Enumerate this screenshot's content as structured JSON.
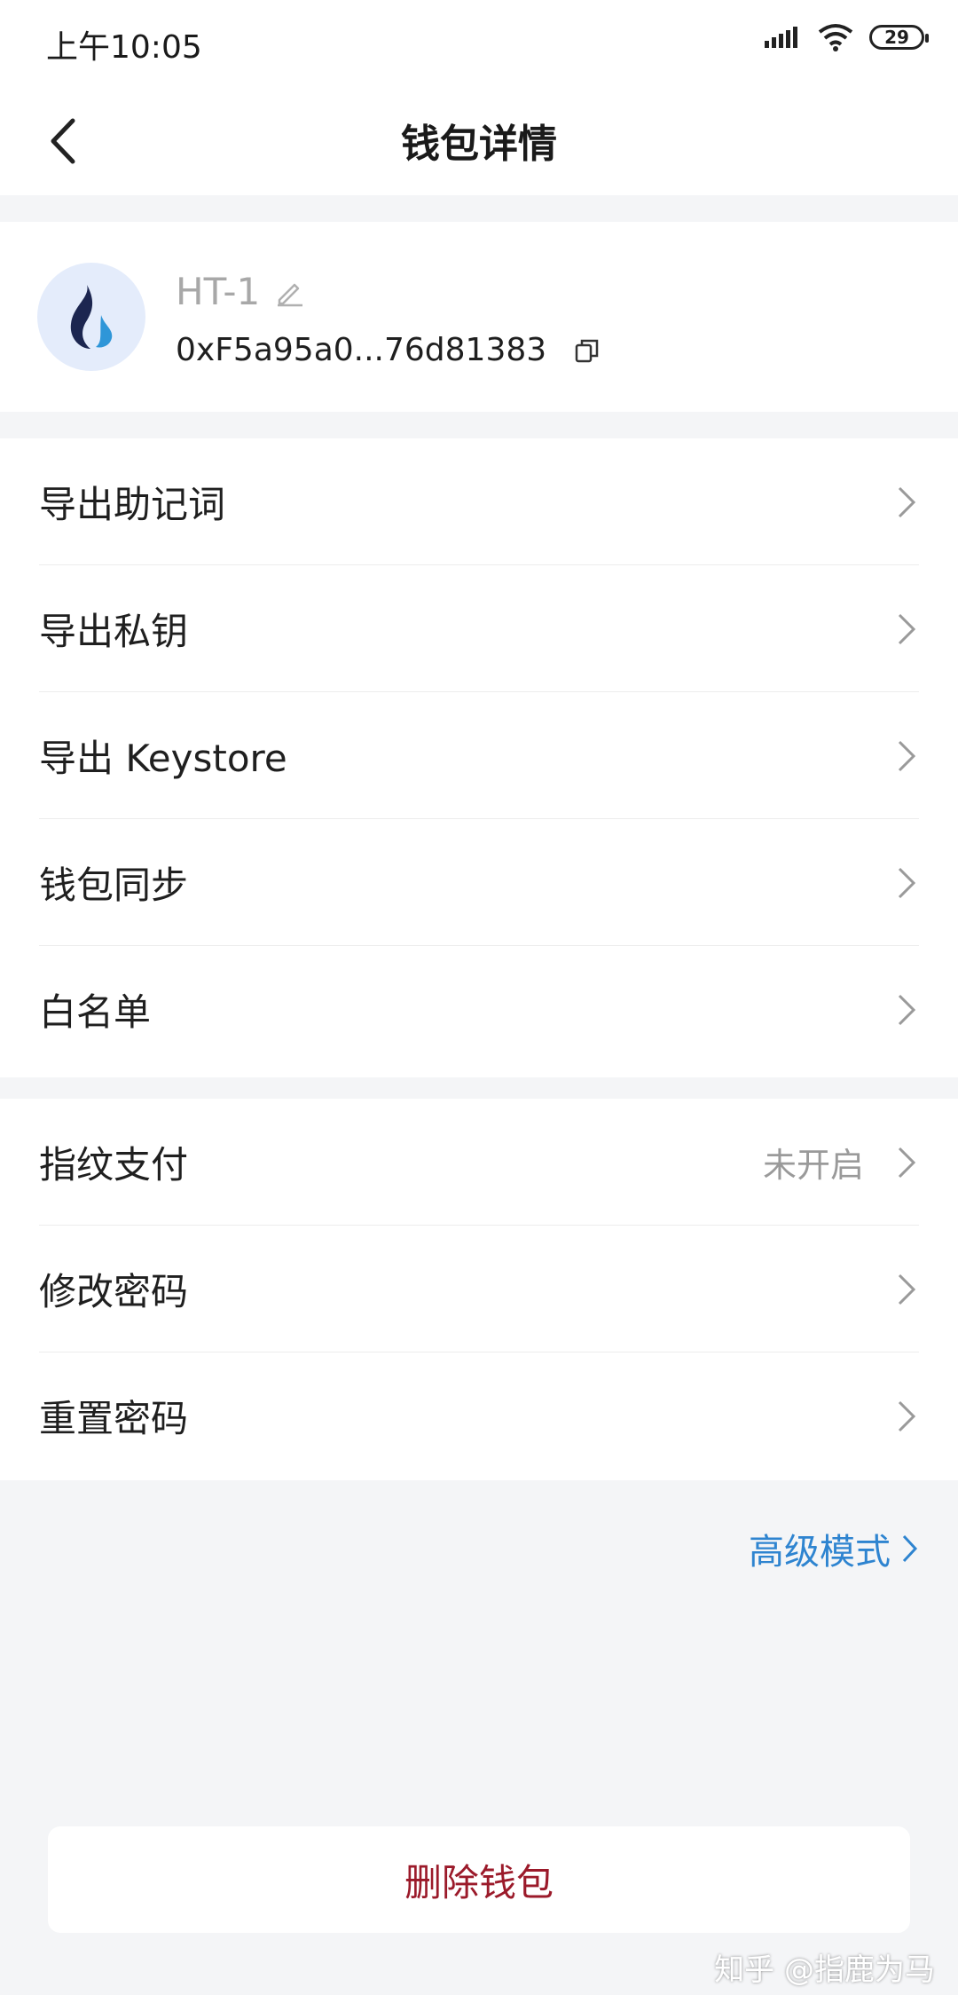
{
  "status_bar": {
    "time": "上午10:05",
    "battery": "29"
  },
  "nav": {
    "title": "钱包详情"
  },
  "wallet": {
    "name": "HT-1",
    "address": "0xF5a95a0...76d81383"
  },
  "menu_group_1": [
    {
      "label": "导出助记词"
    },
    {
      "label": "导出私钥"
    },
    {
      "label": "导出 Keystore"
    },
    {
      "label": "钱包同步"
    },
    {
      "label": "白名单"
    }
  ],
  "menu_group_2": [
    {
      "label": "指纹支付",
      "status": "未开启"
    },
    {
      "label": "修改密码"
    },
    {
      "label": "重置密码"
    }
  ],
  "advanced_mode": "高级模式",
  "delete_button": "删除钱包",
  "watermark": "知乎 @指鹿为马",
  "colors": {
    "accent_blue": "#2e84d0",
    "danger_red": "#9b1a2a",
    "background": "#f4f5f7"
  }
}
